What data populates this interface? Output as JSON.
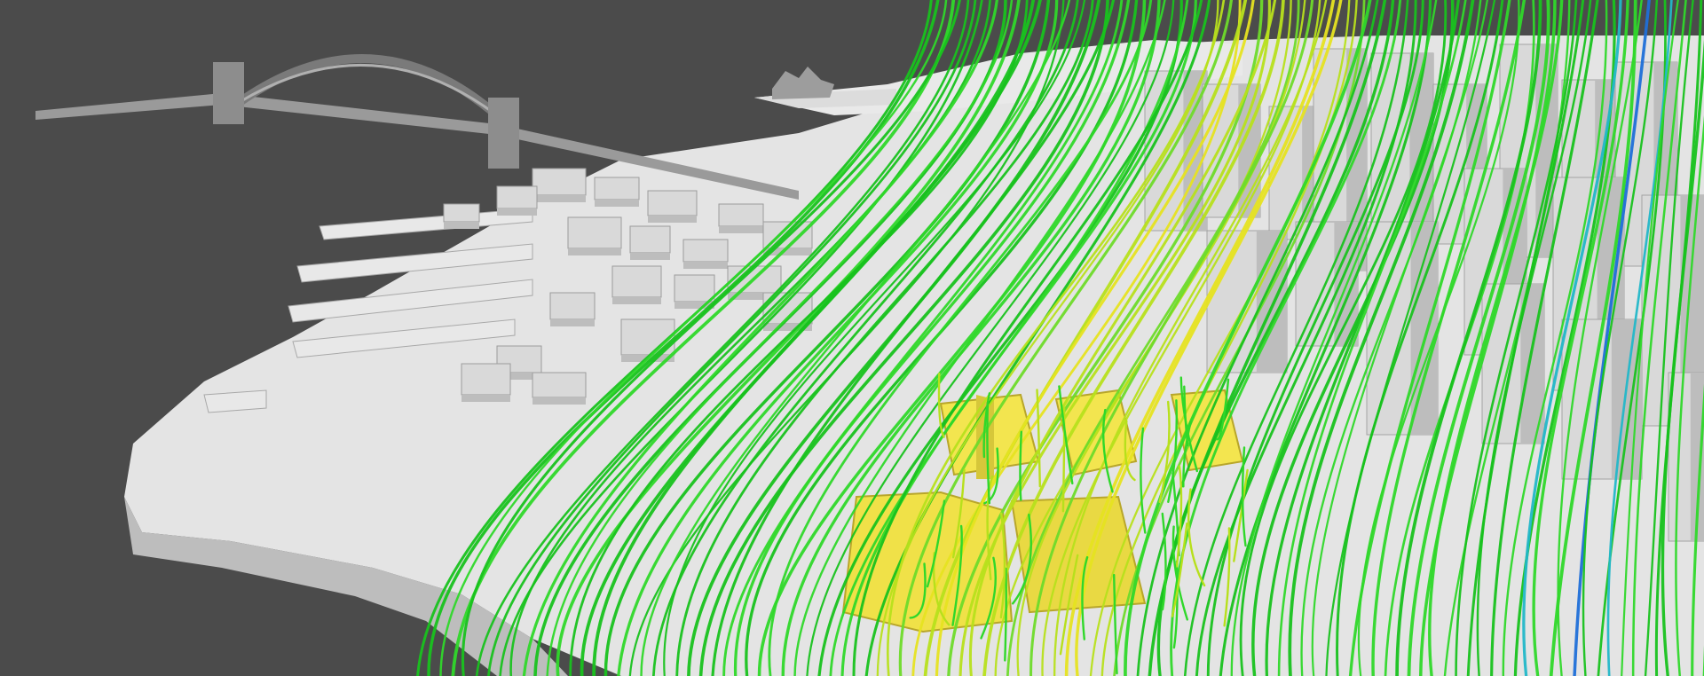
{
  "scene": {
    "kind": "cfd-wind-streamline-visualization",
    "background_color": "#4b4b4b",
    "ground_color": "#e6e6e6",
    "building_color": "#d9d9d9",
    "building_shade_color": "#bdbdbd",
    "highlight_building_color": "#f2e34a",
    "bridge_color": "#8a8a8a",
    "streamline_colors": [
      "#18c21e",
      "#2fd82a",
      "#6edb2a",
      "#b7e01c",
      "#e6e321",
      "#22b7c8",
      "#1f6fd8"
    ]
  }
}
